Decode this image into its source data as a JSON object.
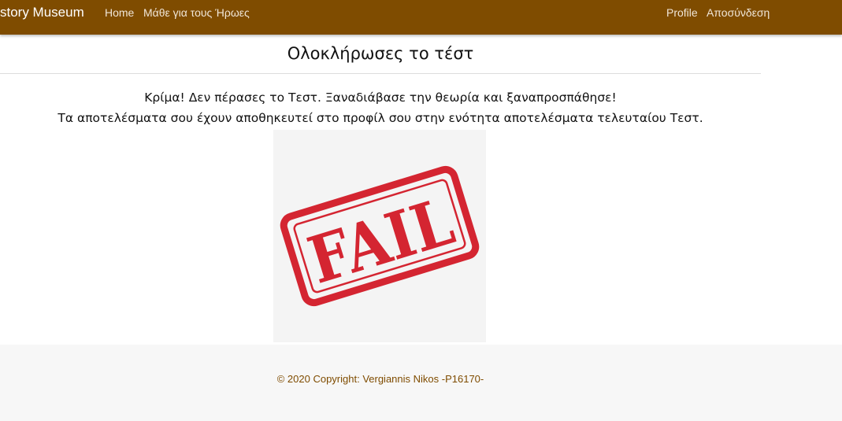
{
  "navbar": {
    "brand": "story Museum",
    "links": {
      "home": "Home",
      "learn": "Μάθε για τους Ήρωες",
      "profile": "Profile",
      "logout": "Αποσύνδεση"
    },
    "background_color": "#7f4c00"
  },
  "main": {
    "title": "Ολοκλήρωσες το τέστ",
    "message_line1": "Κρίμα! Δεν πέρασες το Τεστ. Ξαναδιάβασε την θεωρία και ξαναπροσπάθησε!",
    "message_line2": "Τα αποτελέσματα σου έχουν αποθηκευτεί στο προφίλ σου στην ενότητα αποτελέσματα τελευταίου Τεστ.",
    "stamp_text": "FAIL",
    "stamp_color": "#d42531"
  },
  "footer": {
    "copyright": "© 2020 Copyright: Vergiannis Nikos -P16170-"
  }
}
